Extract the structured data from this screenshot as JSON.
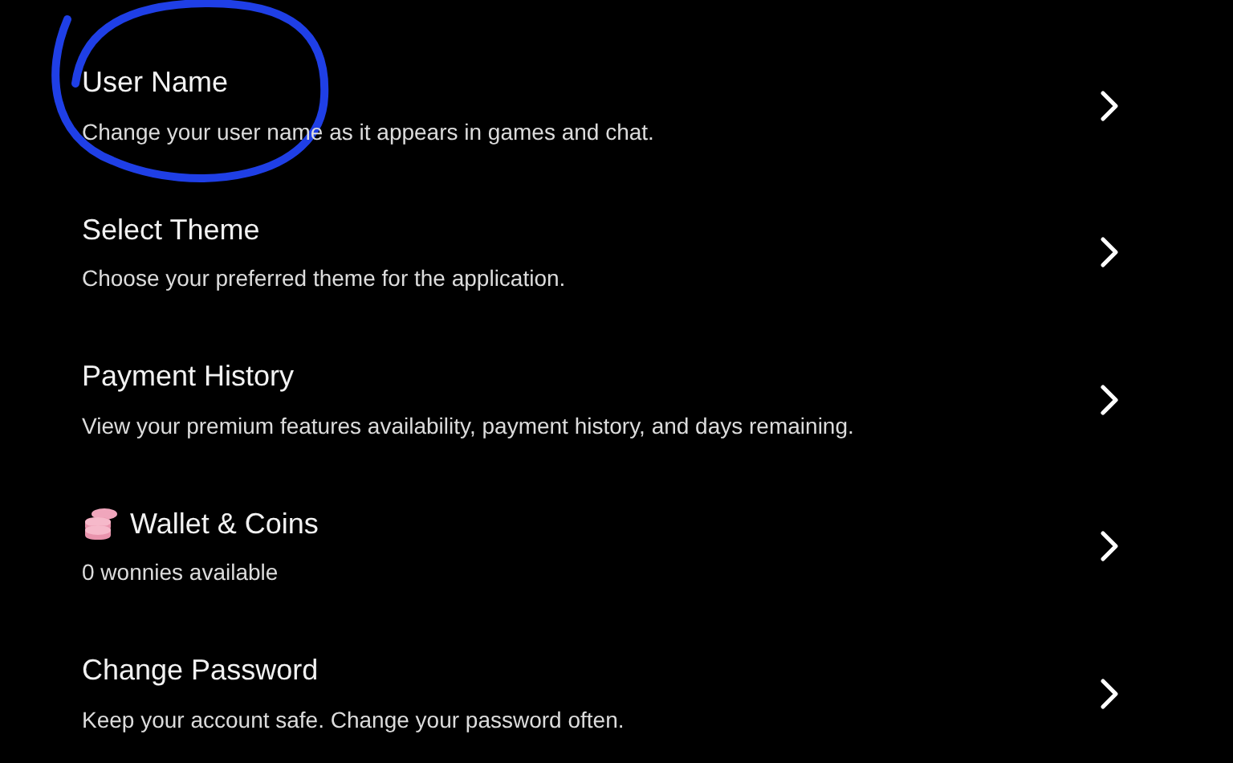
{
  "settings": [
    {
      "kind": "plain",
      "title": "User Name",
      "description": "Change your user name as it appears in games and chat."
    },
    {
      "kind": "plain",
      "title": "Select Theme",
      "description": "Choose your preferred theme for the application."
    },
    {
      "kind": "plain",
      "title": "Payment History",
      "description": "View your premium features availability, payment history, and days remaining."
    },
    {
      "kind": "wallet",
      "title": "Wallet & Coins",
      "description": "0 wonnies available"
    },
    {
      "kind": "plain",
      "title": "Change Password",
      "description": "Keep your account safe. Change your password often."
    }
  ]
}
